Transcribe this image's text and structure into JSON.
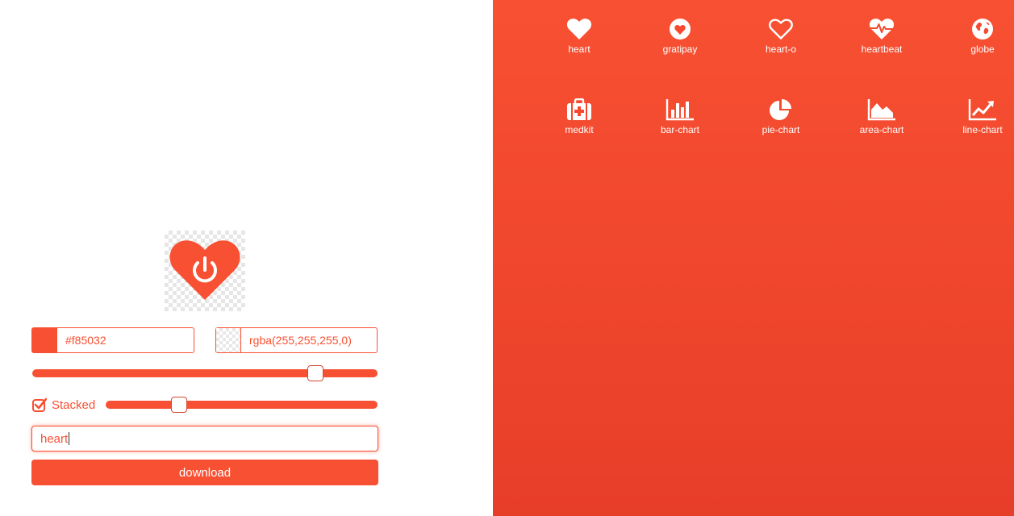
{
  "colors": {
    "accent": "#f85032",
    "accent_dark": "#e73e29",
    "white": "#ffffff"
  },
  "editor": {
    "preview": {
      "icon": "heart-power-icon"
    },
    "foreground_color": "#f85032",
    "background_color": "rgba(255,255,255,0)",
    "size_slider_value": 0.82,
    "stacked": {
      "label": "Stacked",
      "checked": true
    },
    "stack_slider_value": 0.27,
    "search_value": "heart",
    "download_label": "download"
  },
  "icons": [
    {
      "name": "heart",
      "icon": "heart-icon"
    },
    {
      "name": "gratipay",
      "icon": "gratipay-icon"
    },
    {
      "name": "heart-o",
      "icon": "heart-outline-icon"
    },
    {
      "name": "heartbeat",
      "icon": "heartbeat-icon"
    },
    {
      "name": "globe",
      "icon": "globe-icon"
    },
    {
      "name": "medkit",
      "icon": "medkit-icon"
    },
    {
      "name": "bar-chart",
      "icon": "bar-chart-icon"
    },
    {
      "name": "pie-chart",
      "icon": "pie-chart-icon"
    },
    {
      "name": "area-chart",
      "icon": "area-chart-icon"
    },
    {
      "name": "line-chart",
      "icon": "line-chart-icon"
    }
  ]
}
